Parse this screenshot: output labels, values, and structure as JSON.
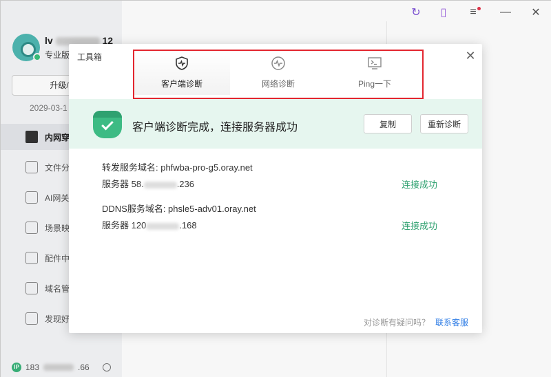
{
  "app": {
    "user_name_prefix": "lv",
    "user_name_suffix": "12",
    "edition": "专业版",
    "upgrade_label": "升级/续",
    "expire_date": "2029-03-1",
    "nav": [
      {
        "label": "内网穿",
        "icon": "cube-icon",
        "active": true
      },
      {
        "label": "文件分",
        "icon": "file-share-icon",
        "active": false
      },
      {
        "label": "AI网关",
        "icon": "ai-icon",
        "active": false
      },
      {
        "label": "场景映",
        "icon": "scene-icon",
        "active": false
      },
      {
        "label": "配件中",
        "icon": "grid-icon",
        "active": false
      },
      {
        "label": "域名管",
        "icon": "domain-icon",
        "active": false
      },
      {
        "label": "发现好",
        "icon": "discover-icon",
        "active": false
      }
    ],
    "ip_prefix": "183",
    "ip_suffix": ".66"
  },
  "dialog": {
    "title": "工具箱",
    "tabs": [
      {
        "label": "客户端诊断",
        "icon": "shield-pulse-icon",
        "active": true
      },
      {
        "label": "网络诊断",
        "icon": "network-pulse-icon",
        "active": false
      },
      {
        "label": "Ping一下",
        "icon": "terminal-icon",
        "active": false
      }
    ],
    "status_text": "客户端诊断完成，连接服务器成功",
    "copy_label": "复制",
    "rediagnose_label": "重新诊断",
    "servers": [
      {
        "domain_label": "转发服务域名: phfwba-pro-g5.oray.net",
        "server_prefix": "服务器 58.",
        "server_suffix": ".236",
        "status": "连接成功"
      },
      {
        "domain_label": "DDNS服务域名: phsle5-adv01.oray.net",
        "server_prefix": "服务器 120",
        "server_suffix": ".168",
        "status": "连接成功"
      }
    ],
    "footer_question": "对诊断有疑问吗？",
    "footer_link": "联系客服"
  },
  "colors": {
    "accent_green": "#2fa170",
    "banner_bg": "#e6f6ef",
    "highlight_red": "#e3262f",
    "link_blue": "#2b7be5"
  }
}
